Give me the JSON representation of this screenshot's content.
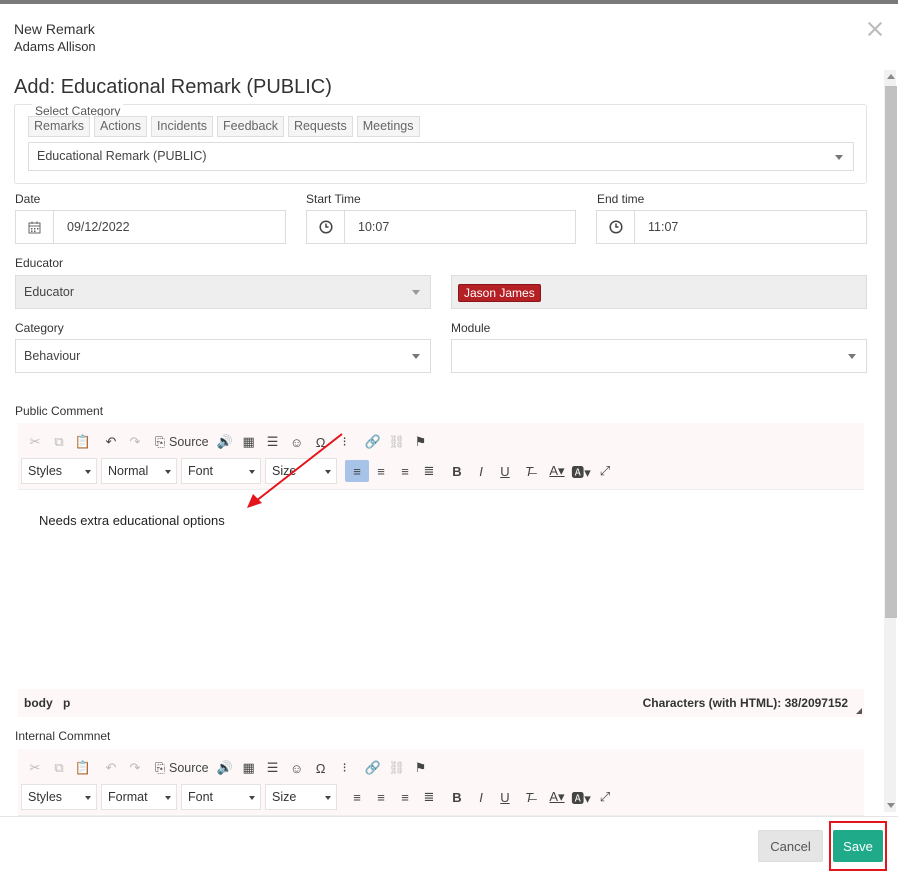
{
  "header": {
    "title": "New Remark",
    "subtitle": "Adams Allison"
  },
  "form": {
    "title": "Add: Educational Remark (PUBLIC)",
    "category_group": {
      "legend": "Select Category",
      "tabs": [
        "Remarks",
        "Actions",
        "Incidents",
        "Feedback",
        "Requests",
        "Meetings"
      ],
      "selected": "Educational Remark (PUBLIC)"
    },
    "date": {
      "label": "Date",
      "value": "09/12/2022"
    },
    "start_time": {
      "label": "Start Time",
      "value": "10:07"
    },
    "end_time": {
      "label": "End time",
      "value": "11:07"
    },
    "educator": {
      "label": "Educator",
      "placeholder": "Educator",
      "tag": "Jason James"
    },
    "category": {
      "label": "Category",
      "value": "Behaviour"
    },
    "module": {
      "label": "Module",
      "value": ""
    },
    "public_comment": {
      "label": "Public Comment",
      "text": "Needs extra educational options",
      "path": [
        "body",
        "p"
      ],
      "char_count": "Characters (with HTML): 38/2097152"
    },
    "internal_comment": {
      "label": "Internal Commnet"
    },
    "toolbar": {
      "source": "Source",
      "styles": "Styles",
      "format_public": "Normal",
      "format_internal": "Format",
      "font": "Font",
      "size": "Size"
    }
  },
  "footer": {
    "cancel": "Cancel",
    "save": "Save"
  },
  "colors": {
    "save": "#1fab89",
    "tag": "#b52025",
    "highlight": "#e4141b"
  }
}
